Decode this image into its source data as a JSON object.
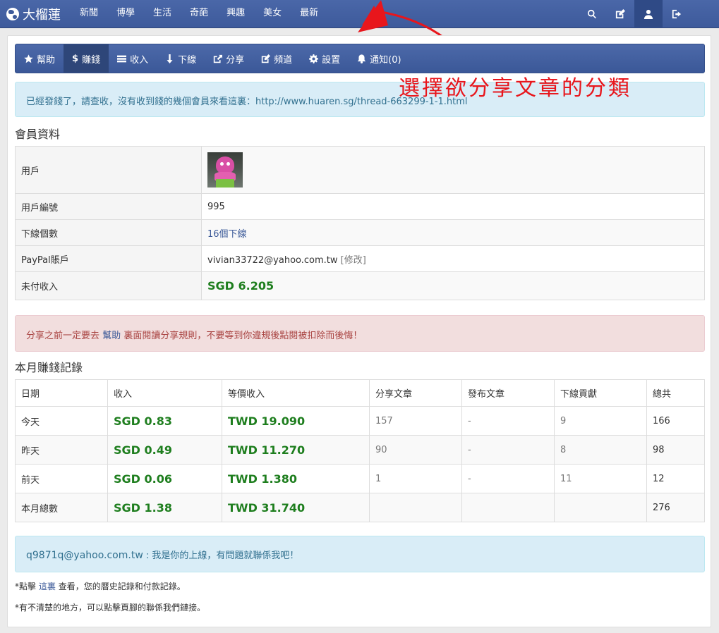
{
  "brand": {
    "name": "大榴蓮"
  },
  "topnav": [
    "新聞",
    "博學",
    "生活",
    "奇葩",
    "興趣",
    "美女",
    "最新"
  ],
  "subnav": [
    {
      "icon": "star-icon",
      "label": "幫助"
    },
    {
      "icon": "dollar-icon",
      "label": "賺錢"
    },
    {
      "icon": "list-icon",
      "label": "收入"
    },
    {
      "icon": "arrow-down-icon",
      "label": "下線"
    },
    {
      "icon": "share-icon",
      "label": "分享"
    },
    {
      "icon": "edit-icon",
      "label": "頻道"
    },
    {
      "icon": "gear-icon",
      "label": "設置"
    },
    {
      "icon": "bell-icon",
      "label": "通知(0)"
    }
  ],
  "notice": "已經發錢了，請查收，沒有收到錢的幾個會員來看這裏：http://www.huaren.sg/thread-663299-1-1.html",
  "annotation": "選擇欲分享文章的分類",
  "member": {
    "title": "會員資料",
    "user_label": "用戶",
    "id_label": "用戶編號",
    "id_value": "995",
    "downline_label": "下線個數",
    "downline_value": "16個下線",
    "paypal_label": "PayPal賬戶",
    "paypal_value": "vivian33722@yahoo.com.tw",
    "paypal_edit": "[修改]",
    "unpaid_label": "未付收入",
    "unpaid_value": "SGD 6.205"
  },
  "warning": {
    "before": "分享之前一定要去",
    "link": "幫助",
    "after": "裏面閱讀分享規則，不要等到你違規後點閱被扣除而後悔！"
  },
  "earnings": {
    "title": "本月賺錢記錄",
    "headers": [
      "日期",
      "收入",
      "等價收入",
      "分享文章",
      "發布文章",
      "下線貢獻",
      "總共"
    ],
    "rows": [
      [
        "今天",
        "SGD 0.83",
        "TWD 19.090",
        "157",
        "-",
        "9",
        "166"
      ],
      [
        "昨天",
        "SGD 0.49",
        "TWD 11.270",
        "90",
        "-",
        "8",
        "98"
      ],
      [
        "前天",
        "SGD 0.06",
        "TWD 1.380",
        "1",
        "-",
        "11",
        "12"
      ],
      [
        "本月總數",
        "SGD 1.38",
        "TWD 31.740",
        "",
        "",
        "",
        "276"
      ]
    ]
  },
  "upline": {
    "email": "q9871q@yahoo.com.tw",
    "message": ": 我是你的上線，有問題就聯係我吧！"
  },
  "notes": {
    "n1_before": "*點擊",
    "n1_link": "這裏",
    "n1_after": "查看，您的曆史記錄和付款記錄。",
    "n2": "*有不清楚的地方，可以點擊頁腳的聯係我們鏈接。"
  },
  "colors": {
    "navbar": "#3d5a9b",
    "green": "#1e7e1e",
    "annotation": "#e8161c"
  }
}
